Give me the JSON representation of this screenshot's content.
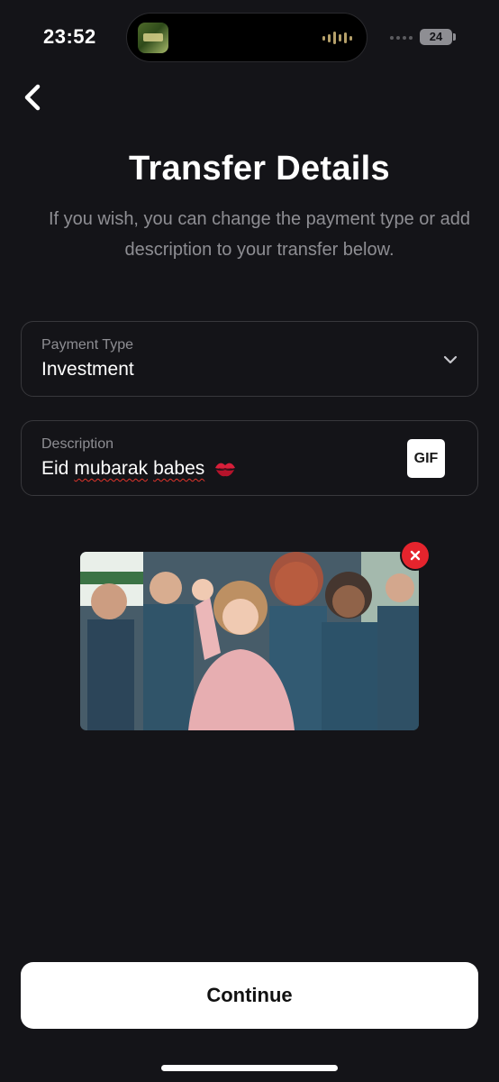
{
  "status_bar": {
    "time": "23:52",
    "battery": "24"
  },
  "header": {
    "back_icon": "chevron-left-icon",
    "title": "Transfer Details",
    "subtitle": "If you wish, you can change the payment type or add description to your transfer below."
  },
  "payment_type": {
    "label": "Payment Type",
    "value": "Investment",
    "icon": "chevron-down-icon"
  },
  "description": {
    "label": "Description",
    "words": [
      "Eid",
      "mubarak",
      "babes"
    ],
    "emoji": "kiss-mark-icon",
    "gif_button_label": "GIF"
  },
  "gif_attachment": {
    "remove_icon": "close-icon"
  },
  "actions": {
    "continue_label": "Continue"
  },
  "colors": {
    "background": "#141418",
    "field_border": "#38383c",
    "muted_text": "#8e8e93",
    "button_bg": "#ffffff",
    "remove_red": "#e5242d",
    "spellcheck_red": "#e0342b"
  }
}
